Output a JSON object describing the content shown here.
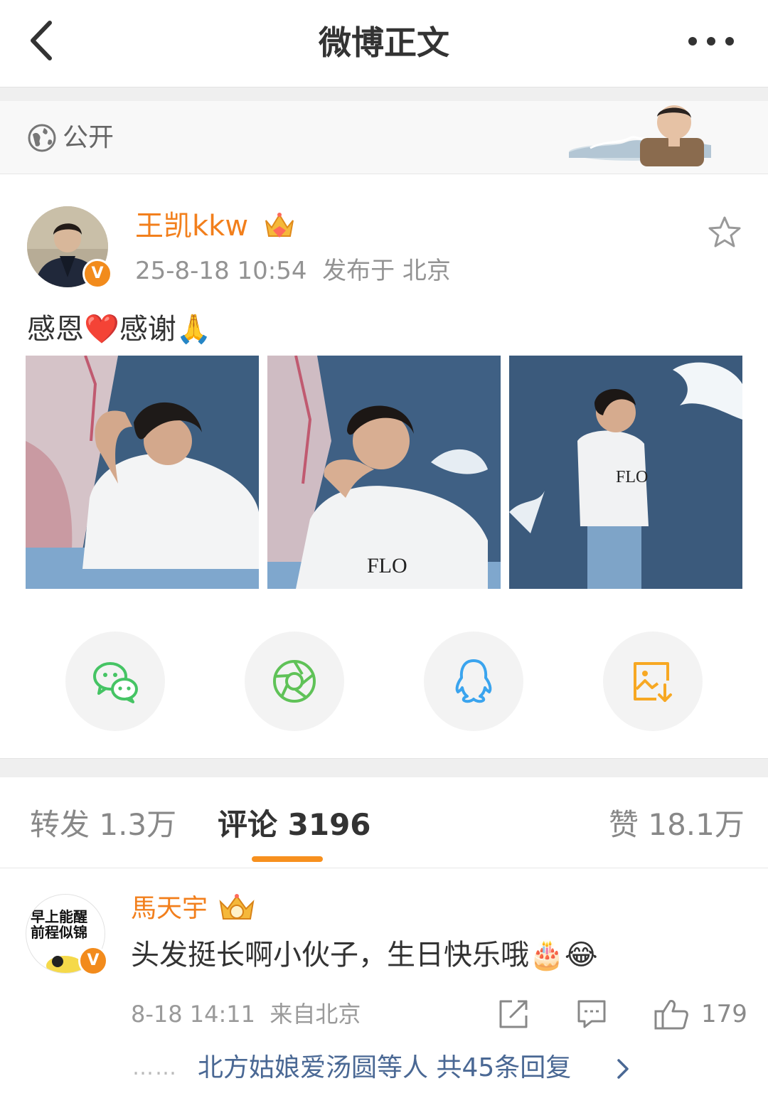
{
  "header": {
    "title": "微博正文",
    "back_icon": "chevron-left-icon",
    "more_icon": "more-dots-icon"
  },
  "visibility": {
    "label": "公开",
    "icon": "globe-icon"
  },
  "post": {
    "author": "王凯kkw",
    "time": "25-8-18 10:54",
    "location": "发布于 北京",
    "verified_badge": "V",
    "text_part1": "感恩",
    "text_emoji1": "❤️",
    "text_part2": "感谢",
    "text_emoji2": "🙏",
    "photos": [
      "photo-1",
      "photo-2",
      "photo-3"
    ]
  },
  "share": [
    {
      "name": "wechat",
      "icon": "wechat-icon",
      "color": "#45c464"
    },
    {
      "name": "moments",
      "icon": "moments-icon",
      "color": "#5fc257"
    },
    {
      "name": "qq",
      "icon": "qq-icon",
      "color": "#3aa4ee"
    },
    {
      "name": "save-image",
      "icon": "save-image-icon",
      "color": "#f7a823"
    }
  ],
  "tabs": {
    "repost": "转发 1.3万",
    "comments": "评论 3196",
    "likes": "赞 18.1万",
    "active": "comments"
  },
  "comment": {
    "user": "馬天宇",
    "avatar_line1": "早上能醒",
    "avatar_line2": "前程似锦",
    "verified_badge": "V",
    "text": "头发挺长啊小伙子，生日快乐哦",
    "emoji1": "🎂",
    "emoji2": "😂",
    "time": "8-18 14:11",
    "source": "来自北京",
    "like_count": "179",
    "dots": "……",
    "replies": "北方姑娘爱汤圆等人  共45条回复"
  },
  "colors": {
    "accent_orange": "#f7901e",
    "username_orange": "#f27f1c",
    "link_blue": "#4a6894"
  }
}
